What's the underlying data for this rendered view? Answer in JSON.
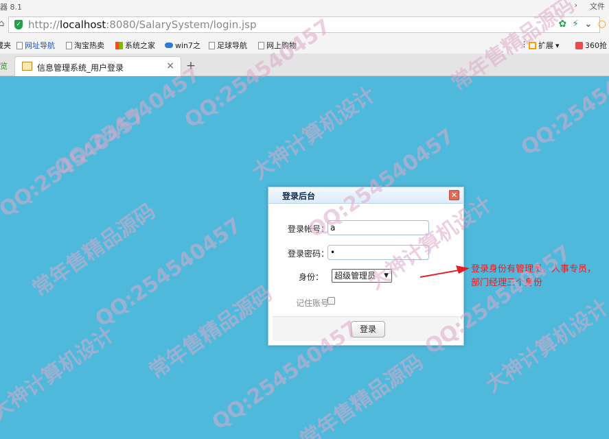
{
  "window": {
    "title_left": "器 8.1",
    "menu_file": "文件"
  },
  "address_bar": {
    "url_prefix": "http://",
    "url_host": "localhost",
    "url_path": ":8080/SalarySystem/login.jsp"
  },
  "bookmarks": [
    {
      "label": "藏夹"
    },
    {
      "label": "网址导航"
    },
    {
      "label": "淘宝热卖"
    },
    {
      "label": "系统之家"
    },
    {
      "label": "win7之"
    },
    {
      "label": "足球导航"
    },
    {
      "label": "网上购物"
    },
    {
      "label": "扩展"
    },
    {
      "label": "360抢"
    }
  ],
  "tabs": {
    "left_fragment": "览",
    "active_title": "信息管理系统_用户登录"
  },
  "dialog": {
    "title": "登录后台",
    "account_label": "登录帐号：",
    "account_value": "a",
    "password_label": "登录密码：",
    "password_mask": "•",
    "role_label": "身份：",
    "role_selected": "超级管理员",
    "remember_label": "记住账号",
    "login_button": "登录"
  },
  "annotation": "登录身份有管理员，人事专员，部门经理三个身份",
  "watermarks": {
    "qq": "QQ:254540457",
    "brand": "常年售精品源码",
    "design": "大神计算机设计"
  },
  "colors": {
    "page_bg": "#4fb9db",
    "annotation": "#e31f26"
  }
}
